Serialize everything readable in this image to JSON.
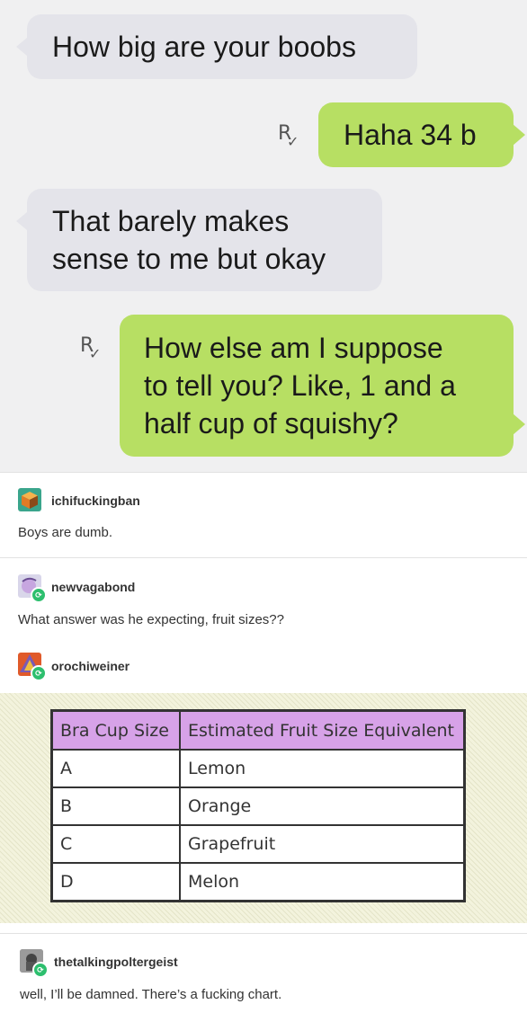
{
  "chat": {
    "messages": [
      {
        "from": "them",
        "text": "How big are your boobs"
      },
      {
        "from": "me",
        "text": "Haha 34 b"
      },
      {
        "from": "them",
        "lines": [
          "That barely makes",
          "sense to me but okay"
        ]
      },
      {
        "from": "me",
        "lines": [
          "How else am I suppose",
          "to tell you? Like, 1 and a",
          "half cup of squishy?"
        ]
      }
    ],
    "read_marker": "R"
  },
  "posts": [
    {
      "username": "ichifuckingban",
      "text": "Boys are dumb."
    },
    {
      "username": "newvagabond",
      "text": "What answer was he expecting, fruit sizes??"
    },
    {
      "username": "orochiweiner"
    },
    {
      "username": "thetalkingpoltergeist",
      "text": "well, I’ll be damned. There’s a fucking chart."
    }
  ],
  "chart_data": {
    "type": "table",
    "columns": [
      "Bra Cup Size",
      "Estimated Fruit Size Equivalent"
    ],
    "rows": [
      [
        "A",
        "Lemon"
      ],
      [
        "B",
        "Orange"
      ],
      [
        "C",
        "Grapefruit"
      ],
      [
        "D",
        "Melon"
      ]
    ],
    "header_color": "#d7a2e8"
  },
  "colors": {
    "sent_bubble": "#b7df63",
    "received_bubble": "#e4e4ea",
    "reblog_badge": "#2dbf6e"
  }
}
